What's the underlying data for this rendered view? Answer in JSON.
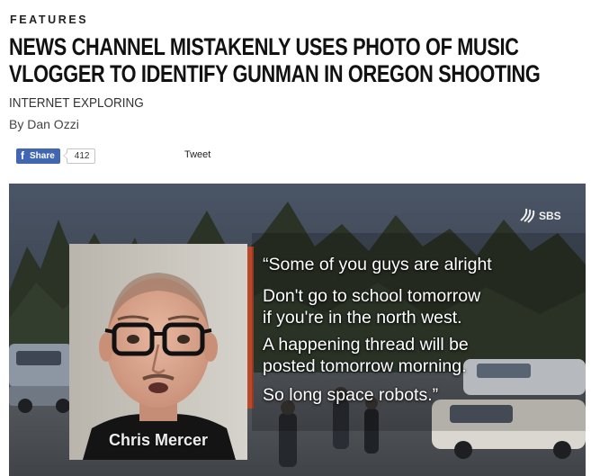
{
  "article": {
    "section": "FEATURES",
    "headline_line1": "NEWS CHANNEL MISTAKENLY USES PHOTO OF MUSIC",
    "headline_line2": "VLOGGER TO IDENTIFY GUNMAN IN OREGON SHOOTING",
    "category": "INTERNET EXPLORING",
    "byline": "By Dan Ozzi"
  },
  "share": {
    "facebook_icon": "f",
    "facebook_label": "Share",
    "facebook_count": "412",
    "tweet_label": "Tweet",
    "facebook_color": "#4267b2"
  },
  "video": {
    "logo_text": "SBS",
    "logo_icon": "sbs-logo-icon",
    "caption_name": "Chris Mercer",
    "quote_lines_1": [
      "“Some of you guys are alright"
    ],
    "quote_lines_2": [
      "Don't go to school tomorrow",
      "if you're in the north west."
    ],
    "quote_lines_3": [
      "A happening thread will be",
      "posted tomorrow morning."
    ],
    "quote_lines_4": [
      "So long space robots.”"
    ]
  }
}
